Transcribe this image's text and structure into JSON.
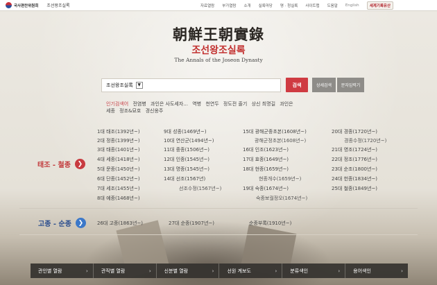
{
  "header": {
    "logo_text": "국사편찬위원회",
    "site_name": "조선왕조실록",
    "nav": [
      "자료열람",
      "부가열람",
      "소개",
      "실록마당",
      "명 · 청실록",
      "사이트맵",
      "도움말"
    ],
    "english": "English",
    "heritage": "세계기록유산"
  },
  "title": {
    "hanja": "朝鮮王朝實錄",
    "korean": "조선왕조실록",
    "english": "The Annals of the Joseon Dynasty"
  },
  "search": {
    "selected": "조선왕조실록",
    "button": "검색",
    "detail_button": "상세검색",
    "text_button": "문자입력기"
  },
  "popular": {
    "label": "인기검색어",
    "keywords": [
      "전염병",
      "과인은 사도세자...",
      "역병",
      "천연두",
      "정도전 줄기",
      "상신 최명길",
      "과인은",
      "세종",
      "정조&묘호",
      "경신옹주"
    ]
  },
  "joseon": {
    "label": "태조 - 철종",
    "col1": [
      "1대 태조(1392년~)",
      "2대 정종(1399년~)",
      "3대 태종(1401년~)",
      "4대 세종(1418년~)",
      "5대 문종(1450년~)",
      "6대 단종(1452년~)",
      "7대 세조(1455년~)",
      "8대 예종(1468년~)"
    ],
    "col2": [
      "9대 성종(1469년~)",
      "10대 연산군(1494년~)",
      "11대 중종(1506년~)",
      "12대 인종(1545년~)",
      "13대 명종(1545년~)",
      "14대 선조(1567년)"
    ],
    "col2_sub": "선조수정(1567년~)",
    "col3": [
      "15대 광해군중초본(1608년~)",
      "광해군정초본(1608년~)",
      "16대 인조(1623년~)",
      "17대 효종(1649년~)",
      "18대 현종(1659년~)",
      "현종개수(1659년~)",
      "19대 숙종(1674년~)",
      "숙종보궐정오(1674년~)"
    ],
    "col4": [
      "20대 경종(1720년~)",
      "경종수정(1720년~)",
      "21대 영조(1724년~)",
      "22대 정조(1776년~)",
      "23대 순조(1800년~)",
      "24대 헌종(1834년~)",
      "25대 철종(1849년~)"
    ]
  },
  "empire": {
    "label": "고종 - 순종",
    "items": [
      "26대 고종(1863년~)",
      "27대 순종(1907년~)",
      "순종부록(1910년~)"
    ]
  },
  "bottom_nav": [
    "관인별 열람",
    "관직별 열람",
    "신분별 열람",
    "선원 계보도",
    "분류색인",
    "용어색인"
  ],
  "icons": {
    "arrow": "chevron-right-icon",
    "select": "dropdown-icon"
  }
}
